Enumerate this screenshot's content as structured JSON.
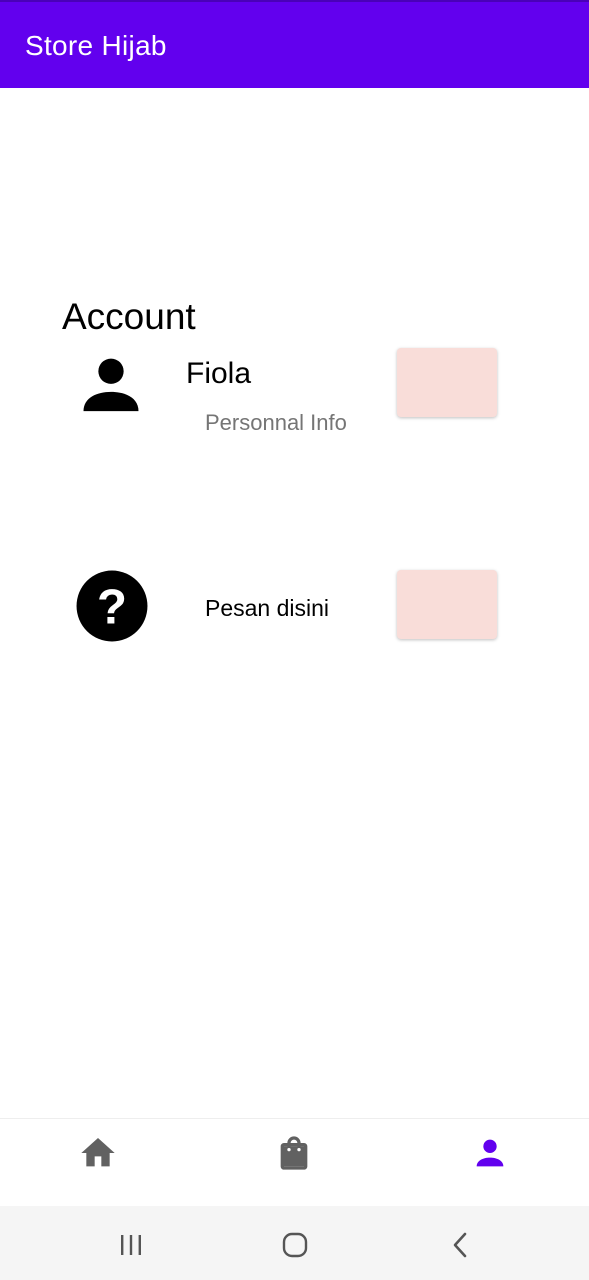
{
  "app_bar": {
    "title": "Store Hijab",
    "color": "#6200EE"
  },
  "account": {
    "section_title": "Account",
    "profile": {
      "name": "Fiola",
      "subtitle": "Personnal Info",
      "icon": "person-icon"
    },
    "help": {
      "label": "Pesan disini",
      "icon": "help-circle-icon"
    },
    "button_color": "#F9DDD9"
  },
  "bottom_nav": {
    "items": [
      {
        "icon": "home-icon",
        "active": false
      },
      {
        "icon": "shopping-bag-icon",
        "active": false
      },
      {
        "icon": "person-icon",
        "active": true
      }
    ],
    "active_color": "#6200EE",
    "inactive_color": "#616161"
  },
  "system_nav": {
    "buttons": [
      "recent-apps-icon",
      "home-circle-icon",
      "back-chevron-icon"
    ]
  }
}
